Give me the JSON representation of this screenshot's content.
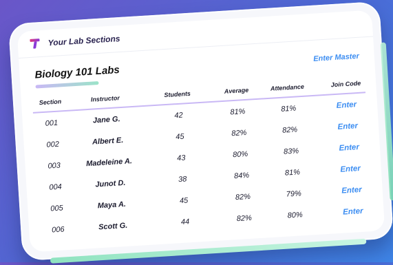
{
  "app": {
    "title": "Your Lab Sections"
  },
  "page": {
    "title": "Biology 101 Labs",
    "enter_master": "Enter Master"
  },
  "table": {
    "headers": [
      "Section",
      "Instructor",
      "Students",
      "Average",
      "Attendance",
      "Join Code"
    ],
    "rows": [
      {
        "section": "001",
        "instructor": "Jane G.",
        "students": "42",
        "average": "81%",
        "attendance": "81%",
        "join": "Enter"
      },
      {
        "section": "002",
        "instructor": "Albert E.",
        "students": "45",
        "average": "82%",
        "attendance": "82%",
        "join": "Enter"
      },
      {
        "section": "003",
        "instructor": "Madeleine A.",
        "students": "43",
        "average": "80%",
        "attendance": "83%",
        "join": "Enter"
      },
      {
        "section": "004",
        "instructor": "Junot D.",
        "students": "38",
        "average": "84%",
        "attendance": "81%",
        "join": "Enter"
      },
      {
        "section": "005",
        "instructor": "Maya A.",
        "students": "45",
        "average": "82%",
        "attendance": "79%",
        "join": "Enter"
      },
      {
        "section": "006",
        "instructor": "Scott G.",
        "students": "44",
        "average": "82%",
        "attendance": "80%",
        "join": "Enter"
      }
    ]
  },
  "colors": {
    "accent": "#3d8ef2",
    "brand_pink": "#e0357a",
    "brand_purple": "#8a3bd8",
    "underline": "#c9b8f5"
  },
  "icons": {
    "logo": "brand-t-logo-icon"
  }
}
